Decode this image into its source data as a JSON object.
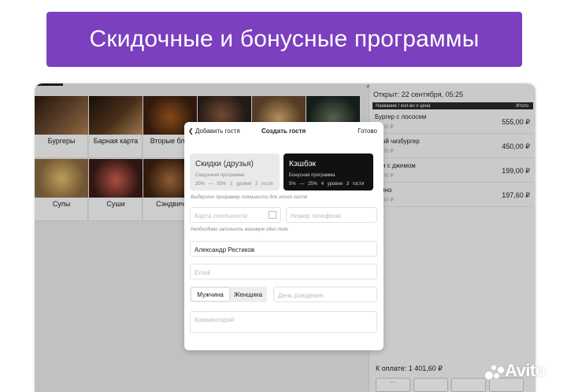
{
  "banner": {
    "title": "Скидочные и бонусные программы"
  },
  "categories": [
    {
      "label": "Бургеры",
      "color": "#5a4030"
    },
    {
      "label": "Барная карта",
      "color": "#3a2a20"
    },
    {
      "label": "Вторые блю",
      "color": "#6b3a20"
    },
    {
      "label": "",
      "color": "#4a3a30"
    },
    {
      "label": "",
      "color": "#8a6a40"
    },
    {
      "label": "",
      "color": "#2f3a35"
    },
    {
      "label": "Супы",
      "color": "#c8a050"
    },
    {
      "label": "Суши",
      "color": "#7a3030"
    },
    {
      "label": "Сэндвич",
      "color": "#6a4020"
    }
  ],
  "order": {
    "opened": "Открыт: 22 сентября, 05:25",
    "col_name": "Название / кол-во х цена",
    "col_total": "Итого",
    "items": [
      {
        "name": "Бургер с лососем",
        "sub": "55,00 ₽",
        "price": "555,00 ₽"
      },
      {
        "name": "йной чизбургер",
        "sub": "50,00 ₽",
        "price": "450,00 ₽"
      },
      {
        "name": "оли с джемом",
        "sub": "99,00 ₽",
        "price": "199,00 ₽"
      },
      {
        "name": "учино",
        "sub": "97,60 ₽",
        "price": "197,60 ₽"
      }
    ],
    "to_pay": "К оплате: 1 401,60 ₽"
  },
  "modal": {
    "back": "Добавить гостя",
    "title": "Создать гостя",
    "done": "Готово",
    "programs": [
      {
        "title": "Скидки (друзья)",
        "type": "Скидочная программа",
        "range": "20% — 50%",
        "levels": "2 уровня",
        "guests": "2 гостя"
      },
      {
        "title": "Кэшбэк",
        "type": "Бонусная программа",
        "range": "5% — 25%",
        "levels": "4 уровня",
        "guests": "3 гостя"
      }
    ],
    "program_hint": "Выберите программу лояльности для этого гостя",
    "card_placeholder": "Карта лояльности",
    "phone_placeholder": "Номер телефона",
    "fields_hint": "Необходимо заполнить минимум одно поле",
    "name_value": "Александр Рестиков",
    "email_placeholder": "Email",
    "gender_male": "Мужчина",
    "gender_female": "Женщина",
    "birthday_placeholder": "День рождения",
    "comment_placeholder": "Комментарий"
  },
  "watermark": "Avito",
  "colors": {
    "banner": "#7b3fbf",
    "selected_program": "#111111"
  }
}
